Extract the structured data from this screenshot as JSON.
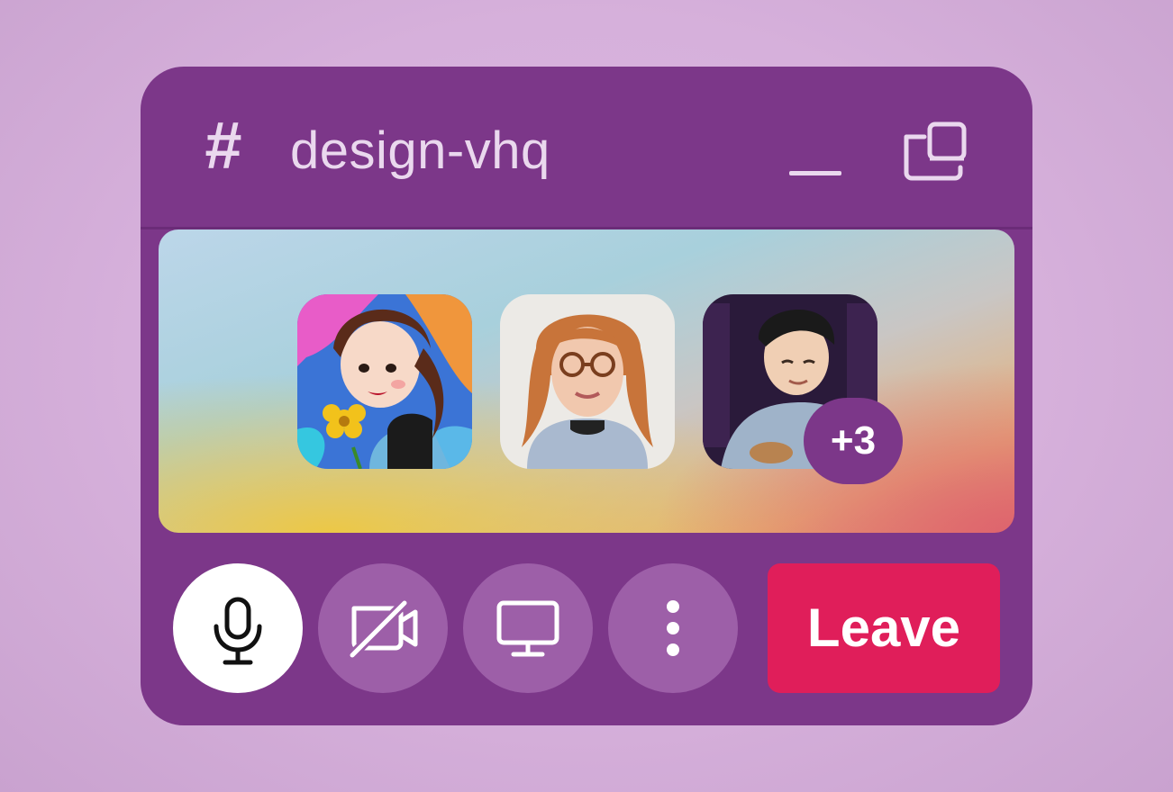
{
  "header": {
    "channel_prefix": "#",
    "channel_name": "design-vhq",
    "minimize_icon": "minimize-icon",
    "popout_icon": "popout-window-icon"
  },
  "stage": {
    "participants": [
      {
        "name": "illustrated-avatar"
      },
      {
        "name": "photo-avatar-glasses"
      },
      {
        "name": "photo-avatar-hat"
      }
    ],
    "overflow_count": "+3"
  },
  "controls": {
    "mic_icon": "microphone-icon",
    "video_icon": "video-off-icon",
    "screen_icon": "screen-share-icon",
    "more_icon": "more-vertical-icon",
    "leave_label": "Leave"
  },
  "colors": {
    "panel": "#7c3789",
    "control": "#9d5fa8",
    "leave": "#e01e5a",
    "header_text": "#ead8ee"
  }
}
